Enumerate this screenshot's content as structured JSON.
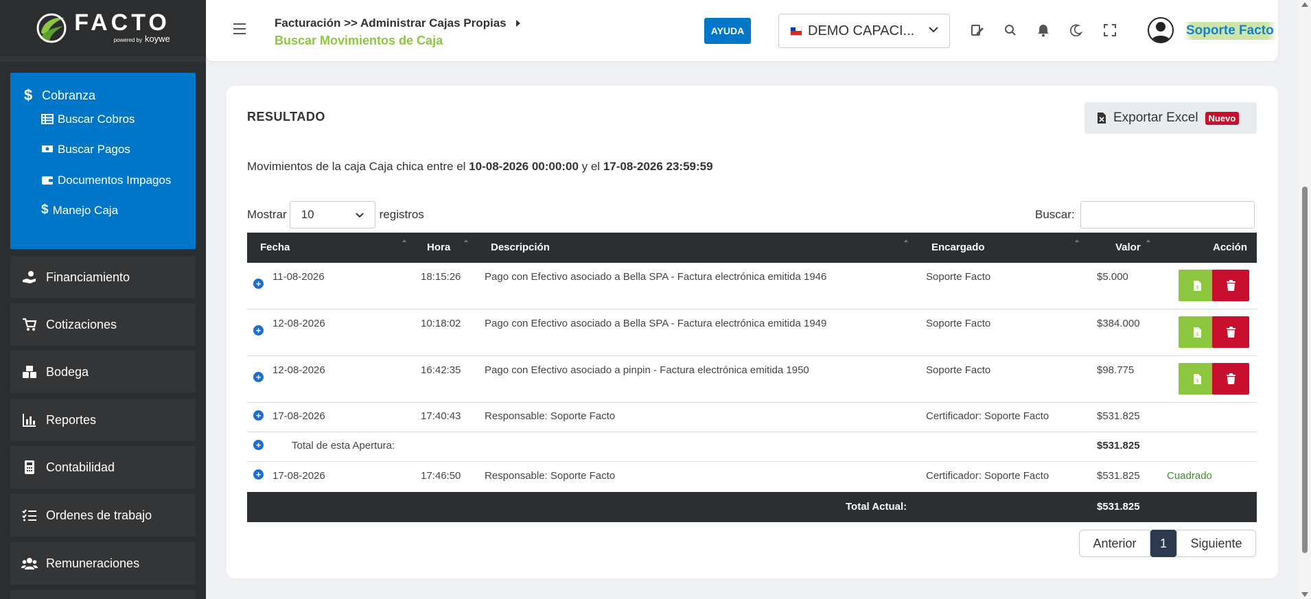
{
  "logo": {
    "name": "FACTO",
    "powered": "powered by",
    "brand": "koywe"
  },
  "sidebar": {
    "open_section": {
      "label": "Cobranza",
      "items": [
        {
          "label": "Buscar Cobros",
          "icon": "table-icon"
        },
        {
          "label": "Buscar Pagos",
          "icon": "money-icon"
        },
        {
          "label": "Documentos Impagos",
          "icon": "wallet-icon"
        },
        {
          "label": "Manejo Caja",
          "icon": "dollar-icon"
        }
      ]
    },
    "items": [
      {
        "label": "Financiamiento",
        "icon": "hand-coin-icon"
      },
      {
        "label": "Cotizaciones",
        "icon": "cart-icon"
      },
      {
        "label": "Bodega",
        "icon": "boxes-icon"
      },
      {
        "label": "Reportes",
        "icon": "chart-icon"
      },
      {
        "label": "Contabilidad",
        "icon": "calculator-icon"
      },
      {
        "label": "Ordenes de trabajo",
        "icon": "checklist-icon"
      },
      {
        "label": "Remuneraciones",
        "icon": "users-icon"
      }
    ]
  },
  "header": {
    "breadcrumb": "Facturación >> Administrar Cajas Propias",
    "current": "Buscar Movimientos de Caja",
    "help": "AYUDA",
    "company": "DEMO CAPACI...",
    "user": "Soporte Facto"
  },
  "card": {
    "title": "RESULTADO",
    "export_label": "Exportar Excel",
    "export_badge": "Nuevo",
    "info_prefix": "Movimientos de la caja Caja chica entre el ",
    "info_from": "10-08-2026 00:00:00",
    "info_mid": " y el ",
    "info_to": "17-08-2026 23:59:59",
    "show_label": "Mostrar",
    "show_value": "10",
    "records_label": "registros",
    "search_label": "Buscar:"
  },
  "table": {
    "headers": {
      "fecha": "Fecha",
      "hora": "Hora",
      "descripcion": "Descripción",
      "encargado": "Encargado",
      "valor": "Valor",
      "accion": "Acción"
    },
    "rows": [
      {
        "fecha": "11-08-2026",
        "hora": "18:15:26",
        "descripcion": "Pago con Efectivo asociado a Bella SPA - Factura electrónica emitida 1946",
        "encargado": "Soporte Facto",
        "valor": "$5.000"
      },
      {
        "fecha": "12-08-2026",
        "hora": "10:18:02",
        "descripcion": "Pago con Efectivo asociado a Bella SPA - Factura electrónica emitida 1949",
        "encargado": "Soporte Facto",
        "valor": "$384.000"
      },
      {
        "fecha": "12-08-2026",
        "hora": "16:42:35",
        "descripcion": "Pago con Efectivo asociado a pinpin - Factura electrónica emitida 1950",
        "encargado": "Soporte Facto",
        "valor": "$98.775"
      }
    ],
    "opening": {
      "fecha": "17-08-2026",
      "hora": "17:40:43",
      "descripcion": "Responsable: Soporte Facto",
      "encargado": "Certificador: Soporte Facto",
      "valor": "$531.825"
    },
    "subtotal": {
      "label": "Total de esta Apertura:",
      "valor": "$531.825"
    },
    "closing": {
      "fecha": "17-08-2026",
      "hora": "17:46:50",
      "descripcion": "Responsable: Soporte Facto",
      "encargado": "Certificador: Soporte Facto",
      "valor": "$531.825",
      "status": "Cuadrado"
    },
    "footer": {
      "label": "Total Actual:",
      "valor": "$531.825"
    }
  },
  "pagination": {
    "prev": "Anterior",
    "current": "1",
    "next": "Siguiente"
  }
}
